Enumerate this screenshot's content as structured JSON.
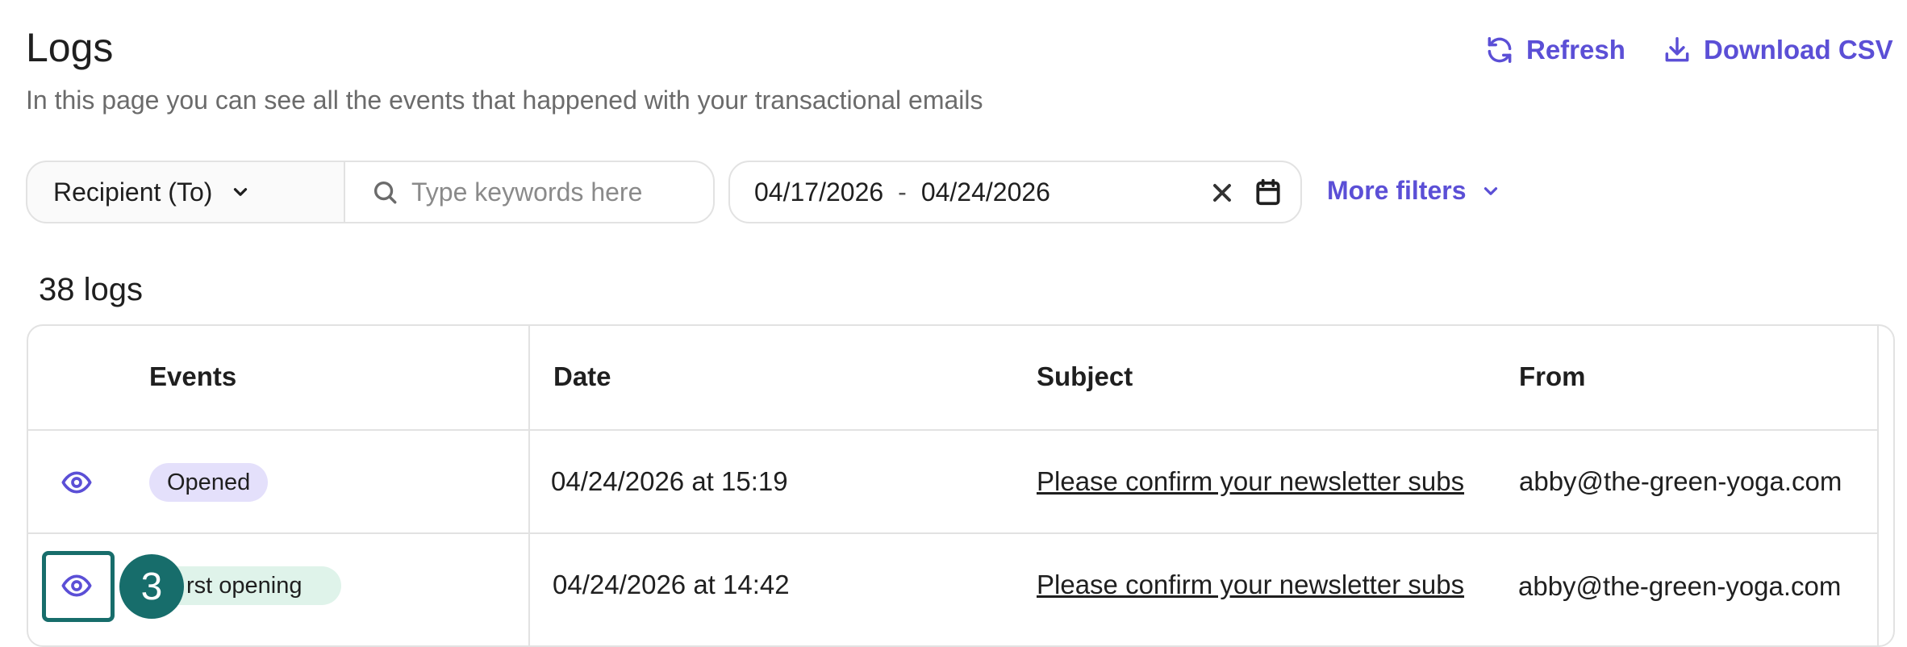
{
  "header": {
    "title": "Logs",
    "subtitle": "In this page you can see all the events that happened with your transactional emails",
    "refresh_label": "Refresh",
    "download_label": "Download CSV"
  },
  "filters": {
    "recipient_label": "Recipient (To)",
    "search_placeholder": "Type keywords here",
    "date_from": "04/17/2026",
    "date_separator": "-",
    "date_to": "04/24/2026",
    "more_filters_label": "More filters"
  },
  "results": {
    "count_label": "38 logs"
  },
  "table": {
    "columns": [
      "Events",
      "Date",
      "Subject",
      "From"
    ],
    "rows": [
      {
        "event": "Opened",
        "date": "04/24/2026 at 15:19",
        "subject": "Please confirm your newsletter subs",
        "from": "abby@the-green-yoga.com"
      },
      {
        "event": "rst opening",
        "date": "04/24/2026  at 14:42",
        "subject": "Please confirm your newsletter subs",
        "from": "abby@the-green-yoga.com"
      }
    ]
  },
  "overlay": {
    "step_number": "3"
  },
  "colors": {
    "accent": "#5b4fd6",
    "opened_badge": "#e4e0fb",
    "first_opening_badge": "#dff3ea",
    "step_marker": "#176d6b"
  }
}
